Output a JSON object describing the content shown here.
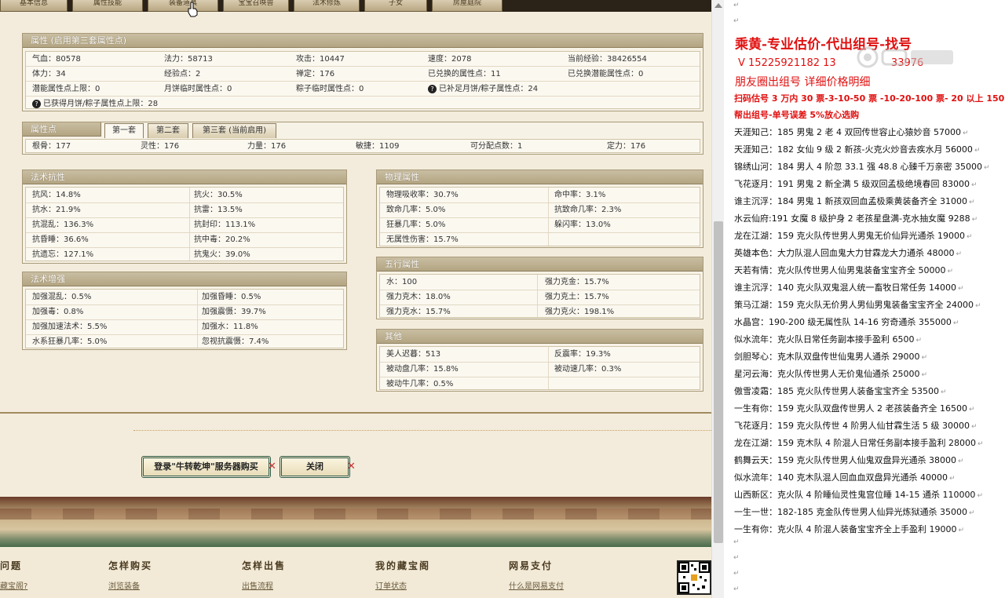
{
  "top_tabs": [
    "基本信息",
    "属性技能",
    "装备道具",
    "宝宝召唤兽",
    "法术修炼",
    "子女",
    "房屋庭院"
  ],
  "attributes": {
    "title": "属性 (启用第三套属性点)",
    "rows": [
      [
        "气血：80578",
        "法力：58713",
        "攻击：10447",
        "速度：2078",
        "当前经验：38426554"
      ],
      [
        "体力：34",
        "经验点：2",
        "禅定：176",
        "已兑换的属性点：11",
        "已兑换潜能属性点：0"
      ],
      [
        "潜能属性点上限：0",
        "月饼临时属性点：0",
        "粽子临时属性点：0",
        "已补足月饼/粽子属性点：24",
        ""
      ]
    ],
    "last_row": "已获得月饼/粽子属性点上限：28"
  },
  "attr_points": {
    "title": "属性点",
    "tabs": [
      "第一套",
      "第二套",
      "第三套 (当前启用)"
    ],
    "values": [
      "根骨：177",
      "灵性：176",
      "力量：176",
      "敏捷：1109",
      "可分配点数：1",
      "定力：176"
    ]
  },
  "magic_resist": {
    "title": "法术抗性",
    "rows": [
      [
        "抗风：14.8%",
        "抗火：30.5%"
      ],
      [
        "抗水：21.9%",
        "抗雷：13.5%"
      ],
      [
        "抗混乱：136.3%",
        "抗封印：113.1%"
      ],
      [
        "抗昏睡：36.6%",
        "抗中毒：20.2%"
      ],
      [
        "抗遗忘：127.1%",
        "抗鬼火：39.0%"
      ]
    ]
  },
  "magic_boost": {
    "title": "法术增强",
    "rows": [
      [
        "加强混乱：0.5%",
        "加强昏睡：0.5%"
      ],
      [
        "加强毒：0.8%",
        "加强震慑：39.7%"
      ],
      [
        "加强加速法术：5.5%",
        "加强水：11.8%"
      ],
      [
        "水系狂暴几率：5.0%",
        "忽视抗震慑：7.4%"
      ]
    ]
  },
  "physical": {
    "title": "物理属性",
    "rows": [
      [
        "物理吸收率：30.7%",
        "命中率：3.1%"
      ],
      [
        "致命几率：5.0%",
        "抗致命几率：2.3%"
      ],
      [
        "狂暴几率：5.0%",
        "躲闪率：13.0%"
      ],
      [
        "无属性伤害：15.7%",
        ""
      ]
    ]
  },
  "five_elements": {
    "title": "五行属性",
    "rows": [
      [
        "水：100",
        "强力克金：15.7%"
      ],
      [
        "强力克木：18.0%",
        "强力克土：15.7%"
      ],
      [
        "强力克水：15.7%",
        "强力克火：198.1%"
      ]
    ]
  },
  "other": {
    "title": "其他",
    "rows": [
      [
        "美人迟暮：513",
        "反震率：19.3%"
      ],
      [
        "被动盘几率：15.8%",
        "被动速几率：0.3%"
      ],
      [
        "被动牛几率：0.5%",
        ""
      ]
    ]
  },
  "buttons": {
    "login": "登录\"牛转乾坤\"服务器购买",
    "close": "关闭"
  },
  "footer": {
    "heads": [
      "问题",
      "怎样购买",
      "怎样出售",
      "我的藏宝阁",
      "网易支付"
    ],
    "links": [
      "藏宝阁?",
      "浏览装备",
      "出售流程",
      "订单状态",
      "什么是网易支付"
    ]
  },
  "notes": {
    "title": "乘黄-专业估价-代出组号-找号",
    "phone": "V 15225921182  13                 33976",
    "friends": "朋友圈出组号    详细价格明细",
    "price": "扫码估号 3 万内 30 票-3-10-50 票  -10-20-100 票- 20 以上 150",
    "help": "帮出组号-单号误差 5%放心选购",
    "entries": [
      "天涯知己：185 男鬼 2 老 4 双回传世容止心猿妙音 57000",
      "天涯知己：182 女仙 9 级 2 新孩-火克火炒音去疾水月 56000",
      "锦绣山河：184 男人 4 阶忽 33.1 强 48.8 心臻千万亲密 35000",
      "飞花逐月：191 男鬼 2 新全满 5 级双回孟极绝境春回 83000",
      "谁主沉浮：184 男鬼 1 新孩双回血孟极乘黄装备齐全 31000",
      "水云仙府:191 女魔 8 级护身 2 老孩星盘满-克水抽女魔 9288",
      "龙在江湖：159 克火队传世男人男鬼无价仙异光通杀 19000",
      "英雄本色：大力队混人回血鬼大力甘霖龙大力通杀 48000",
      "天若有情：克火队传世男人仙男鬼装备宝宝齐全 50000",
      "谁主沉浮：140 克火队双鬼混人统一畜牧日常任务 14000",
      "策马江湖：159 克火队无价男人男仙男鬼装备宝宝齐全 24000",
      "水晶宫：190-200 级无属性队 14-16 穷奇通杀 355000",
      "似水流年：克火队日常任务副本接手盈利 6500",
      "剑胆琴心：克木队双盘传世仙鬼男人通杀 29000",
      "星河云海：克火队传世男人无价鬼仙通杀 25000",
      "傲雪凌霜：185 克火队传世男人装备宝宝齐全 53500",
      "一生有你：159 克火队双盘传世男人 2 老孩装备齐全 16500",
      "飞花逐月：159 克火队传世 4 阶男人仙甘霖生活 5 级 30000",
      "龙在江湖：159 克木队 4 阶混人日常任务副本接手盈利 28000",
      "鹤舞云天：159 克火队传世男人仙鬼双盘异光通杀 38000",
      "似水流年：140 克木队混人回血血双盘异光通杀 40000",
      "山西新区：克火队 4 阶睡仙灵性鬼宫位睡 14-15 通杀 110000",
      "一生一世：182-185 克金队传世男人仙异光炼狱通杀 35000",
      "一生有你：克火队 4 阶混人装备宝宝齐全上手盈利 19000"
    ]
  },
  "colors": {
    "accent_red": "#e01010",
    "panel_head": "#b3a582",
    "button_border": "#2f5a4a"
  }
}
